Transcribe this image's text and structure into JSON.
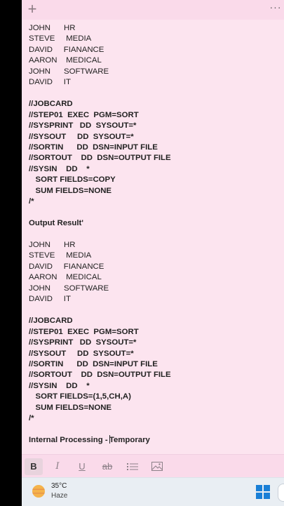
{
  "titlebar": {
    "add_icon": "plus-icon",
    "more_icon": "more-options-icon",
    "more_glyph": "···"
  },
  "note": {
    "lines": [
      {
        "text": "JOHN      HR",
        "bold": false
      },
      {
        "text": "STEVE     MEDIA",
        "bold": false
      },
      {
        "text": "DAVID     FIANANCE",
        "bold": false
      },
      {
        "text": "AARON    MEDICAL",
        "bold": false
      },
      {
        "text": "JOHN      SOFTWARE",
        "bold": false
      },
      {
        "text": "DAVID     IT",
        "bold": false
      },
      {
        "text": "",
        "bold": false
      },
      {
        "text": "//JOBCARD",
        "bold": true
      },
      {
        "text": "//STEP01  EXEC  PGM=SORT",
        "bold": true
      },
      {
        "text": "//SYSPRINT   DD  SYSOUT=*",
        "bold": true
      },
      {
        "text": "//SYSOUT     DD  SYSOUT=*",
        "bold": true
      },
      {
        "text": "//SORTIN      DD  DSN=INPUT FILE",
        "bold": true
      },
      {
        "text": "//SORTOUT    DD  DSN=OUTPUT FILE",
        "bold": true
      },
      {
        "text": "//SYSIN    DD    *",
        "bold": true
      },
      {
        "text": "   SORT FIELDS=COPY",
        "bold": true
      },
      {
        "text": "   SUM FIELDS=NONE",
        "bold": true
      },
      {
        "text": "/*",
        "bold": true
      },
      {
        "text": "",
        "bold": false
      },
      {
        "text": "Output Result'",
        "bold": true
      },
      {
        "text": "",
        "bold": false
      },
      {
        "text": "JOHN      HR",
        "bold": false
      },
      {
        "text": "STEVE     MEDIA",
        "bold": false
      },
      {
        "text": "DAVID     FIANANCE",
        "bold": false
      },
      {
        "text": "AARON    MEDICAL",
        "bold": false
      },
      {
        "text": "JOHN      SOFTWARE",
        "bold": false
      },
      {
        "text": "DAVID     IT",
        "bold": false
      },
      {
        "text": "",
        "bold": false
      },
      {
        "text": "//JOBCARD",
        "bold": true
      },
      {
        "text": "//STEP01  EXEC  PGM=SORT",
        "bold": true
      },
      {
        "text": "//SYSPRINT   DD  SYSOUT=*",
        "bold": true
      },
      {
        "text": "//SYSOUT     DD  SYSOUT=*",
        "bold": true
      },
      {
        "text": "//SORTIN      DD  DSN=INPUT FILE",
        "bold": true
      },
      {
        "text": "//SORTOUT    DD  DSN=OUTPUT FILE",
        "bold": true
      },
      {
        "text": "//SYSIN    DD    *",
        "bold": true
      },
      {
        "text": "   SORT FIELDS=(1,5,CH,A)",
        "bold": true
      },
      {
        "text": "   SUM FIELDS=NONE",
        "bold": true
      },
      {
        "text": "/*",
        "bold": true
      },
      {
        "text": "",
        "bold": false
      },
      {
        "text": "Internal Processing - Temporary",
        "bold": true,
        "caret_after": 22
      }
    ]
  },
  "toolbar": {
    "bold_label": "B",
    "italic_label": "I",
    "underline_label": "U",
    "strike_label": "ab",
    "list_icon": "bulleted-list-icon",
    "image_icon": "image-icon"
  },
  "taskbar": {
    "temperature": "35°C",
    "condition": "Haze",
    "weather_icon": "haze-weather-icon",
    "start_icon": "windows-start-icon"
  },
  "colors": {
    "note_bg": "#fce4ef",
    "titlebar_bg": "#fadaea",
    "accent": "#1a7fd6"
  }
}
